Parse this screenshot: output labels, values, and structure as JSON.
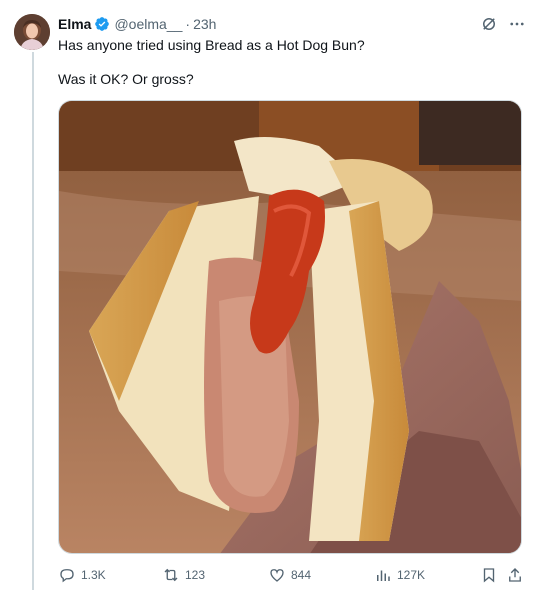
{
  "tweet": {
    "author_name": "Elma",
    "handle": "@oelma__",
    "separator": "·",
    "time": "23h",
    "line1": "Has anyone tried using Bread as a Hot Dog Bun?",
    "line2": "Was it OK? Or gross?"
  },
  "stats": {
    "replies": "1.3K",
    "reposts": "123",
    "likes": "844",
    "views": "127K"
  },
  "icons": {
    "verified": "verified-badge-icon",
    "grok": "grok-icon",
    "more": "more-icon",
    "reply": "reply-icon",
    "repost": "repost-icon",
    "like": "heart-icon",
    "views": "views-icon",
    "bookmark": "bookmark-icon",
    "share": "share-icon"
  },
  "colors": {
    "verified": "#1d9bf0",
    "muted": "#536471",
    "text": "#0f1419",
    "border": "#cfd9de"
  }
}
